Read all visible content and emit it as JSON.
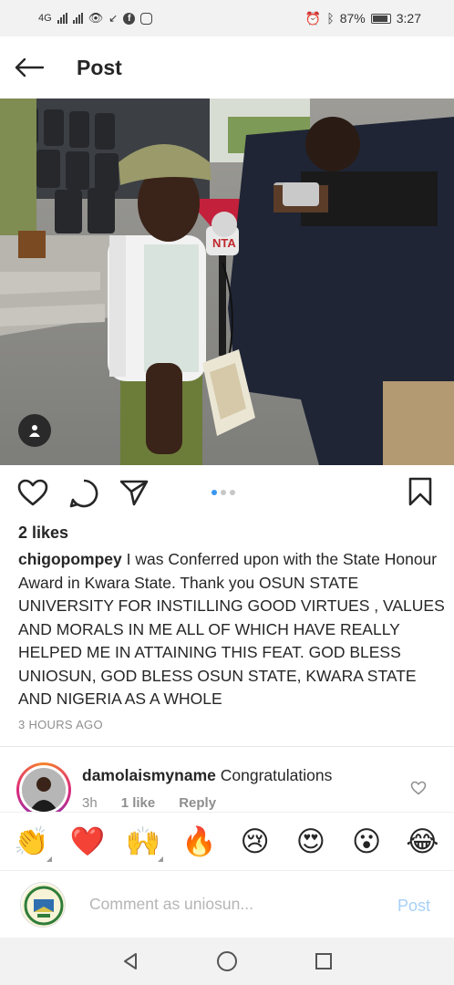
{
  "status_bar": {
    "network": "4G",
    "battery": "87%",
    "time": "3:27"
  },
  "header": {
    "title": "Post"
  },
  "post": {
    "likes": "2 likes",
    "username": "chigopompey",
    "caption": "I was Conferred upon with the State Honour Award in Kwara State. Thank you OSUN STATE UNIVERSITY FOR INSTILLING GOOD VIRTUES , VALUES AND MORALS IN ME ALL OF WHICH  HAVE REALLY HELPED ME IN ATTAINING THIS FEAT. GOD BLESS UNIOSUN, GOD BLESS OSUN STATE, KWARA STATE AND NIGERIA AS A WHOLE",
    "time_ago": "3 HOURS AGO",
    "photo_badge": "NTA",
    "carousel_count": 3,
    "carousel_active": 1
  },
  "comment": {
    "username": "damolaismyname",
    "text": "Congratulations",
    "time": "3h",
    "likes": "1 like",
    "reply": "Reply"
  },
  "emoji_bar": {
    "items": [
      "👏",
      "❤️",
      "🙌",
      "🔥",
      "😢",
      "😍",
      "😮",
      "😂"
    ]
  },
  "comment_input": {
    "placeholder": "Comment as uniosun...",
    "post_label": "Post"
  },
  "colors": {
    "accent": "#3897f0",
    "post_disabled": "#a7d0f6",
    "heart_red": "#ed4956"
  }
}
